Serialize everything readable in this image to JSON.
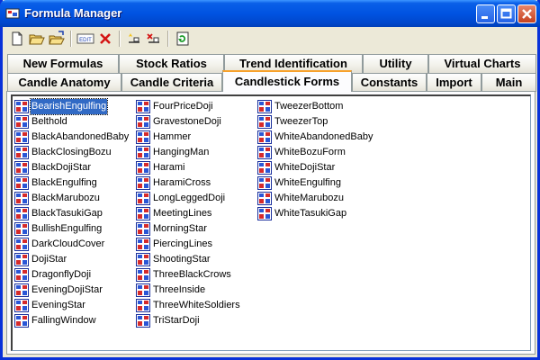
{
  "window": {
    "title": "Formula Manager"
  },
  "colors": {
    "titlebar": "#0053e1",
    "selection": "#316ac5",
    "active_tab_accent": "#f7a12b"
  },
  "toolbar": {
    "buttons": [
      {
        "name": "new-icon"
      },
      {
        "name": "open-folder-icon"
      },
      {
        "name": "open-folder-arrow-icon"
      },
      {
        "name": "edit-icon",
        "label": "EDIT"
      },
      {
        "name": "delete-icon"
      },
      {
        "name": "new-item-icon"
      },
      {
        "name": "remove-item-icon"
      },
      {
        "name": "refresh-icon"
      }
    ]
  },
  "tabs": {
    "row1": [
      "New Formulas",
      "Stock Ratios",
      "Trend Identification",
      "Utility",
      "Virtual Charts"
    ],
    "row2": [
      "Candle Anatomy",
      "Candle Criteria",
      "Candlestick Forms",
      "Constants",
      "Import",
      "Main"
    ],
    "active": "Candlestick Forms"
  },
  "list": {
    "selected": "BearishEngulfing",
    "columns": [
      [
        "BearishEngulfing",
        "Belthold",
        "BlackAbandonedBaby",
        "BlackClosingBozu",
        "BlackDojiStar",
        "BlackEngulfing",
        "BlackMarubozu",
        "BlackTasukiGap",
        "BullishEngulfing",
        "DarkCloudCover",
        "DojiStar",
        "DragonflyDoji",
        "EveningDojiStar",
        "EveningStar",
        "FallingWindow"
      ],
      [
        "FourPriceDoji",
        "GravestoneDoji",
        "Hammer",
        "HangingMan",
        "Harami",
        "HaramiCross",
        "LongLeggedDoji",
        "MeetingLines",
        "MorningStar",
        "PiercingLines",
        "ShootingStar",
        "ThreeBlackCrows",
        "ThreeInside",
        "ThreeWhiteSoldiers",
        "TriStarDoji"
      ],
      [
        "TweezerBottom",
        "TweezerTop",
        "WhiteAbandonedBaby",
        "WhiteBozuForm",
        "WhiteDojiStar",
        "WhiteEngulfing",
        "WhiteMarubozu",
        "WhiteTasukiGap"
      ]
    ]
  }
}
